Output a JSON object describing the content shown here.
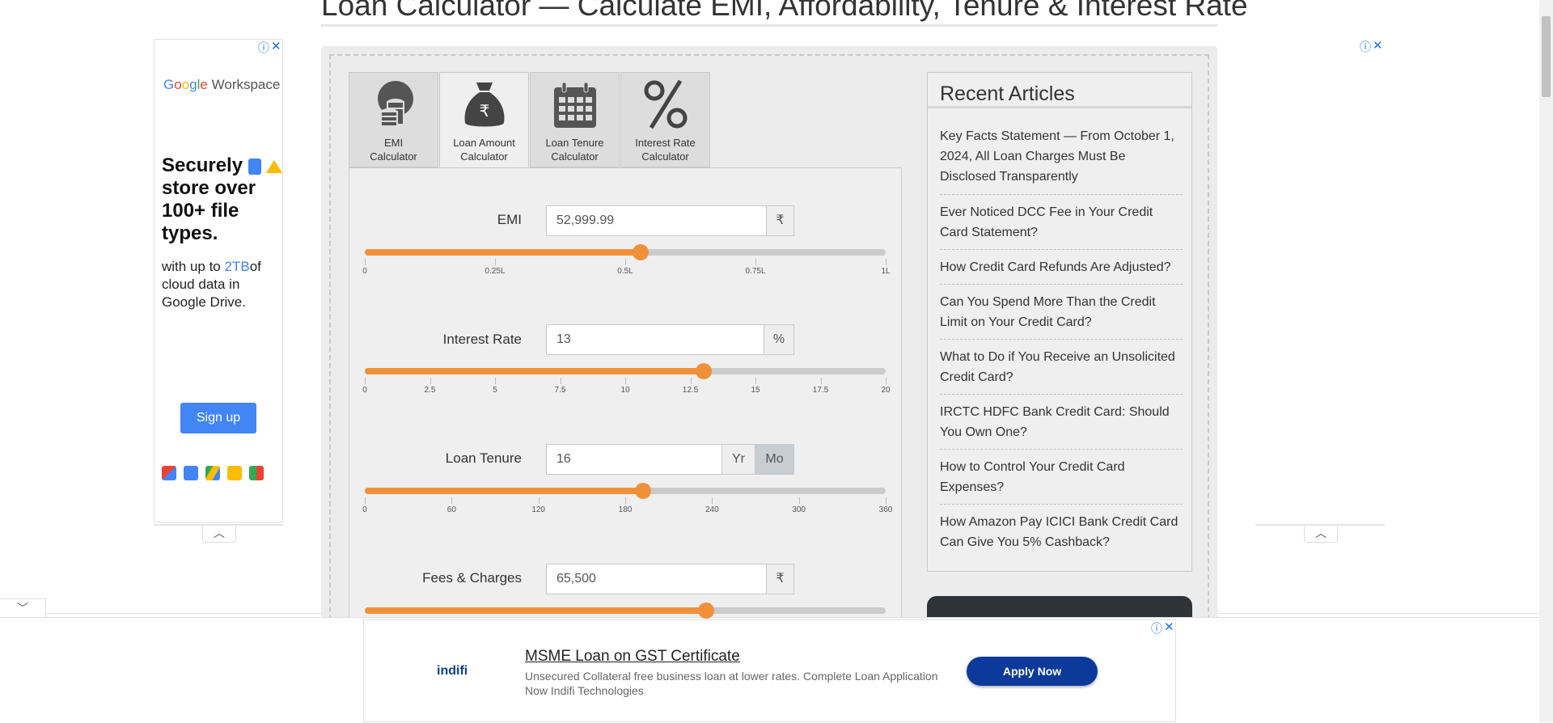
{
  "page": {
    "title": "Loan Calculator — Calculate EMI, Affordability, Tenure & Interest Rate"
  },
  "left_ad": {
    "info_icon": "info-icon",
    "close_icon": "close-icon",
    "logo_google": [
      "G",
      "o",
      "o",
      "g",
      "l",
      "e"
    ],
    "logo_suffix": "Workspace",
    "headline_1": "Securely",
    "headline_2": "store over 100+ file types.",
    "body_prefix": "with up to ",
    "body_highlight": "2TB",
    "body_suffix": "of cloud data in Google Drive.",
    "cta": "Sign up",
    "collapse_icon": "chevron-up-icon"
  },
  "right_ad": {
    "info_icon": "info-icon",
    "close_icon": "close-icon",
    "collapse_icon": "chevron-up-icon"
  },
  "page_collapse_icon": "chevron-down-icon",
  "tabs": [
    {
      "label_1": "EMI",
      "label_2": "Calculator",
      "icon": "coins-icon",
      "active": false
    },
    {
      "label_1": "Loan Amount",
      "label_2": "Calculator",
      "icon": "money-bag-icon",
      "active": true
    },
    {
      "label_1": "Loan Tenure",
      "label_2": "Calculator",
      "icon": "calendar-icon",
      "active": false
    },
    {
      "label_1": "Interest Rate",
      "label_2": "Calculator",
      "icon": "percent-icon",
      "active": false
    }
  ],
  "fields": {
    "emi": {
      "label": "EMI",
      "value": "52,999.99",
      "unit": "₹",
      "slider_fraction": 0.53,
      "ticks": [
        "0",
        "0.25L",
        "0.5L",
        "0.75L",
        "1L"
      ]
    },
    "interest": {
      "label": "Interest Rate",
      "value": "13",
      "unit": "%",
      "slider_fraction": 0.65,
      "ticks": [
        "0",
        "2.5",
        "5",
        "7.5",
        "10",
        "12.5",
        "15",
        "17.5",
        "20"
      ]
    },
    "tenure": {
      "label": "Loan Tenure",
      "value": "16",
      "unit_yr": "Yr",
      "unit_mo": "Mo",
      "selected_unit": "Mo",
      "slider_fraction": 0.534,
      "ticks": [
        "0",
        "60",
        "120",
        "180",
        "240",
        "300",
        "360"
      ]
    },
    "fees": {
      "label": "Fees & Charges",
      "value": "65,500",
      "unit": "₹",
      "slider_fraction": 0.655
    }
  },
  "sidebar": {
    "title": "Recent Articles",
    "articles": [
      "Key Facts Statement — From October 1, 2024, All Loan Charges Must Be Disclosed Transparently",
      "Ever Noticed DCC Fee in Your Credit Card Statement?",
      "How Credit Card Refunds Are Adjusted?",
      "Can You Spend More Than the Credit Limit on Your Credit Card?",
      "What to Do if You Receive an Unsolicited Credit Card?",
      "IRCTC HDFC Bank Credit Card: Should You Own One?",
      "How to Control Your Credit Card Expenses?",
      "How Amazon Pay ICICI Bank Credit Card Can Give You 5% Cashback?"
    ]
  },
  "bottom_ad": {
    "brand": "indifi",
    "title": "MSME Loan on GST Certificate",
    "description": "Unsecured Collateral free business loan at lower rates. Complete Loan Application Now Indifi Technologies",
    "cta": "Apply Now",
    "info_icon": "info-icon",
    "close_icon": "close-icon"
  },
  "colors": {
    "accent": "#f0913a",
    "track": "#cbcbcb",
    "ad_button": "#4285f4",
    "apply_button": "#0b3a9b"
  }
}
